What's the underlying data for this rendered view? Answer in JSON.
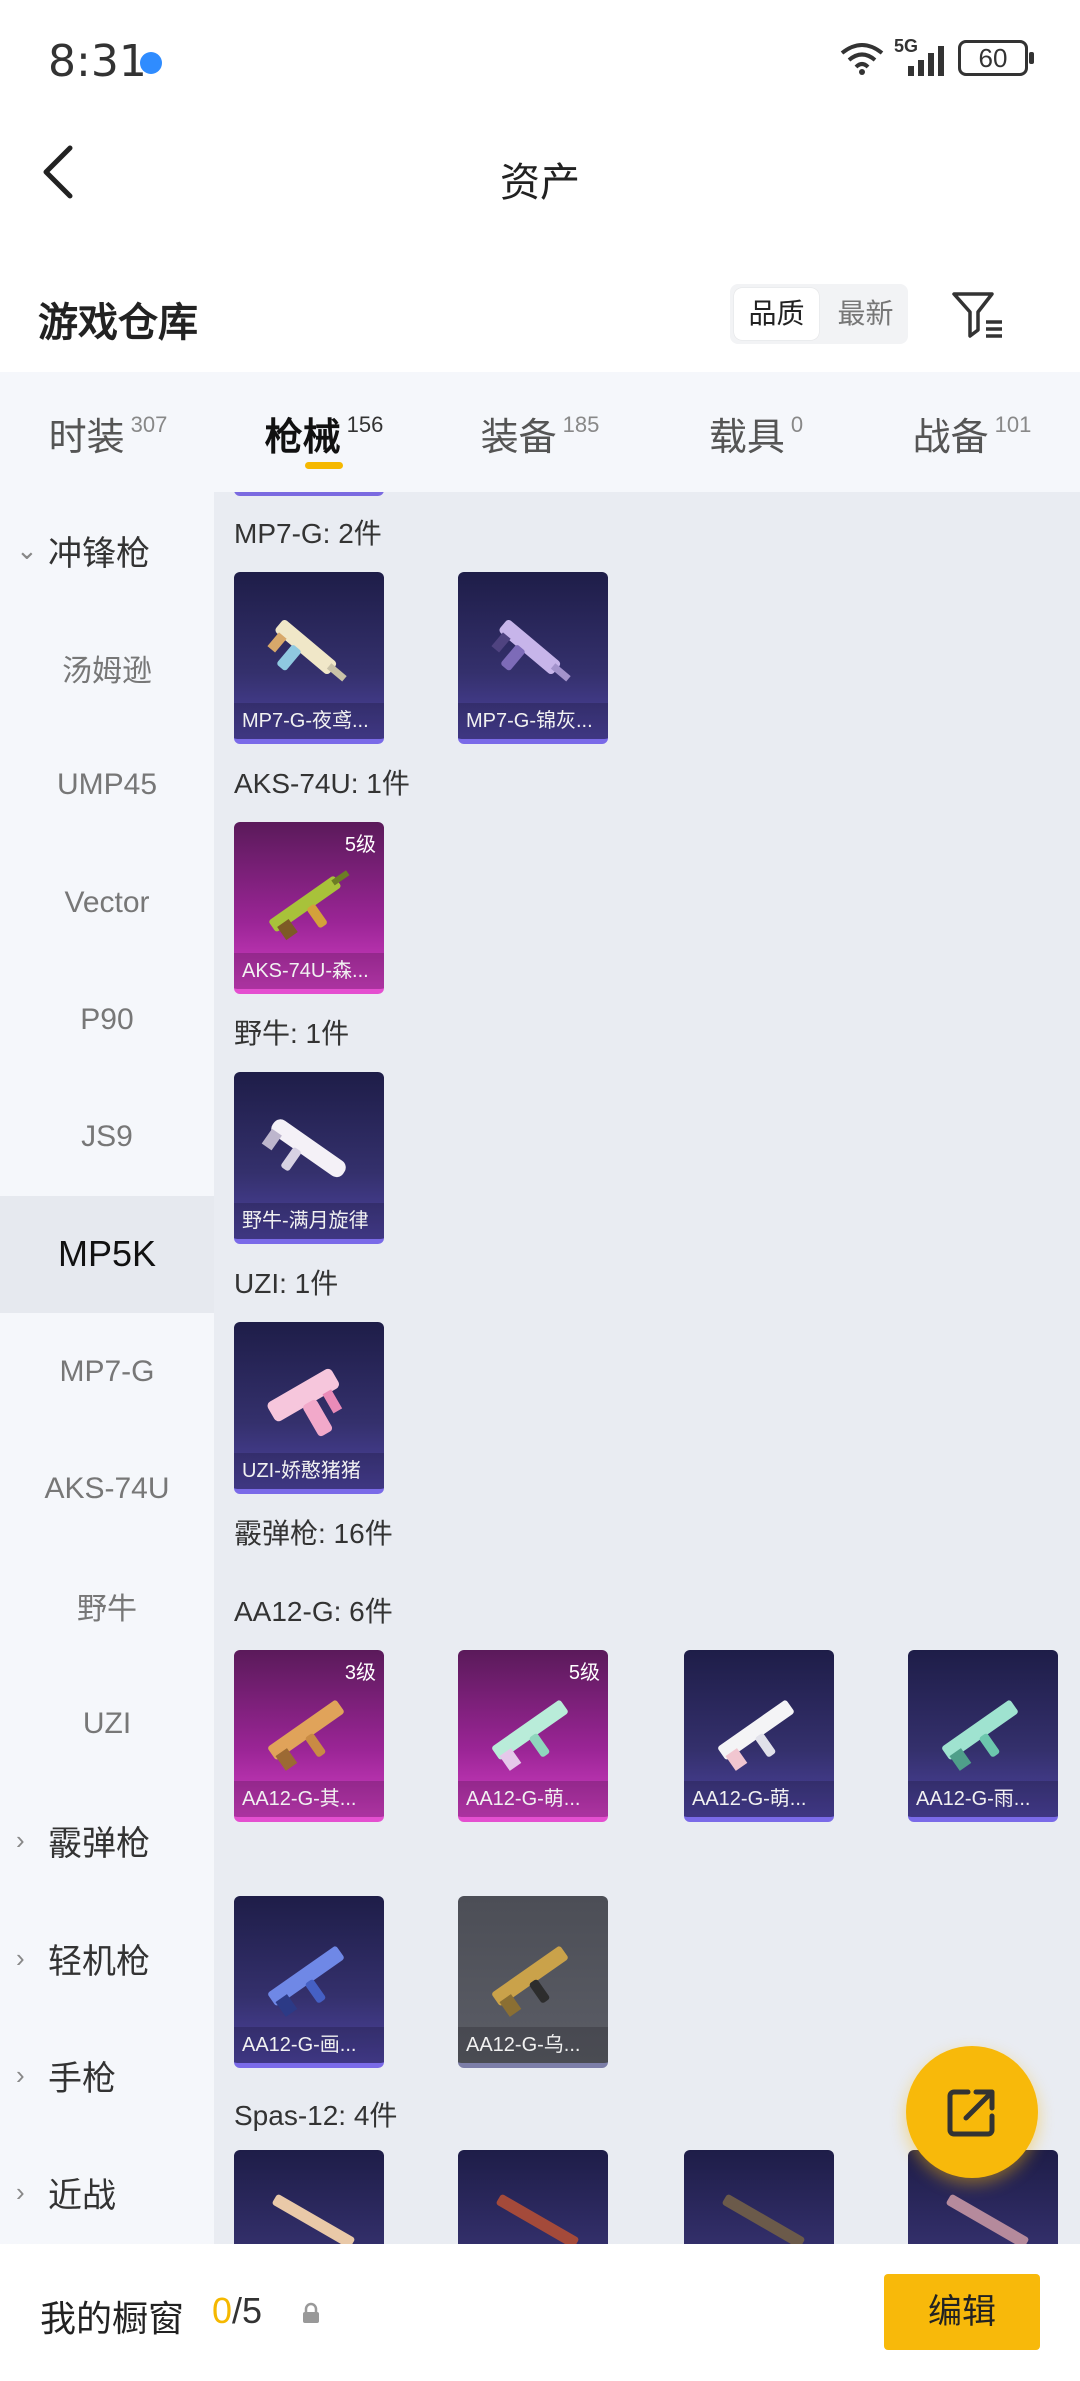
{
  "status": {
    "time": "8:31",
    "network": "5G",
    "battery": "60"
  },
  "title_bar": {
    "title": "资产"
  },
  "section": {
    "title": "游戏仓库",
    "sort_options": [
      "品质",
      "最新"
    ],
    "sort_active": "品质"
  },
  "tabs": [
    {
      "label": "时装",
      "count": "307"
    },
    {
      "label": "枪械",
      "count": "156",
      "active": true
    },
    {
      "label": "装备",
      "count": "185"
    },
    {
      "label": "载具",
      "count": "0"
    },
    {
      "label": "战备",
      "count": "101"
    }
  ],
  "sidebar": {
    "items": [
      {
        "label": "冲锋枪",
        "type": "category",
        "expanded": true
      },
      {
        "label": "汤姆逊"
      },
      {
        "label": "UMP45"
      },
      {
        "label": "Vector"
      },
      {
        "label": "P90"
      },
      {
        "label": "JS9"
      },
      {
        "label": "MP5K",
        "active": true
      },
      {
        "label": "MP7-G"
      },
      {
        "label": "AKS-74U"
      },
      {
        "label": "野牛"
      },
      {
        "label": "UZI"
      },
      {
        "label": "霰弹枪",
        "type": "category"
      },
      {
        "label": "轻机枪",
        "type": "category"
      },
      {
        "label": "手枪",
        "type": "category"
      },
      {
        "label": "近战",
        "type": "category"
      }
    ]
  },
  "content": {
    "groups": [
      {
        "label": "MP7-G: 2件",
        "cards": [
          {
            "name": "MP7-G-夜鸢...",
            "rarity": "purple"
          },
          {
            "name": "MP7-G-锦灰...",
            "rarity": "purple"
          }
        ]
      },
      {
        "label": "AKS-74U: 1件",
        "cards": [
          {
            "name": "AKS-74U-森...",
            "rarity": "pink",
            "level": "5级"
          }
        ]
      },
      {
        "label": "野牛: 1件",
        "cards": [
          {
            "name": "野牛-满月旋律",
            "rarity": "purple"
          }
        ]
      },
      {
        "label": "UZI: 1件",
        "cards": [
          {
            "name": "UZI-娇憨猪猪",
            "rarity": "purple"
          }
        ]
      }
    ],
    "category_label": "霰弹枪: 16件",
    "aa12": {
      "label": "AA12-G: 6件",
      "cards": [
        {
          "name": "AA12-G-其...",
          "rarity": "pink",
          "level": "3级"
        },
        {
          "name": "AA12-G-萌...",
          "rarity": "pink",
          "level": "5级"
        },
        {
          "name": "AA12-G-萌...",
          "rarity": "purple"
        },
        {
          "name": "AA12-G-雨...",
          "rarity": "purple"
        },
        {
          "name": "AA12-G-画...",
          "rarity": "purple"
        },
        {
          "name": "AA12-G-乌...",
          "rarity": "grey"
        }
      ]
    },
    "spas": {
      "label": "Spas-12: 4件"
    }
  },
  "bottom": {
    "showcase_label": "我的橱窗",
    "showcase_used": "0",
    "showcase_total": "/5",
    "edit_label": "编辑"
  },
  "colors": {
    "accent": "#f8b90a",
    "purple_card": "#34306c",
    "pink_card": "#9b2596"
  }
}
